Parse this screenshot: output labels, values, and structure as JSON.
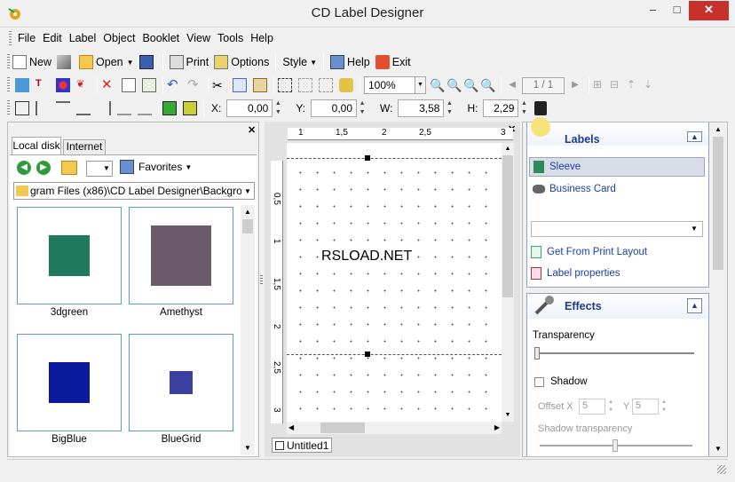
{
  "window": {
    "title": "CD Label Designer",
    "minimize": "–",
    "maximize": "□",
    "close": "✕"
  },
  "menu": [
    "File",
    "Edit",
    "Label",
    "Object",
    "Booklet",
    "View",
    "Tools",
    "Help"
  ],
  "toolbar1": {
    "new": "New",
    "open": "Open",
    "print": "Print",
    "options": "Options",
    "style": "Style",
    "help": "Help",
    "exit": "Exit"
  },
  "toolbar2": {
    "zoom": "100%",
    "page": "1 / 1"
  },
  "toolbar3": {
    "x_label": "X:",
    "x_value": "0,00",
    "y_label": "Y:",
    "y_value": "0,00",
    "w_label": "W:",
    "w_value": "3,58",
    "h_label": "H:",
    "h_value": "2,29"
  },
  "left_panel": {
    "tabs": [
      "Local disk",
      "Internet"
    ],
    "favorites": "Favorites",
    "path": "gram Files (x86)\\CD Label Designer\\Backgrounds",
    "thumbnails": [
      {
        "label": "3dgreen",
        "color": "#1e7a5c"
      },
      {
        "label": "Amethyst",
        "color": "#6b5a6a"
      },
      {
        "label": "BigBlue",
        "color": "#0a1a9a"
      },
      {
        "label": "BlueGrid",
        "color": "#3a3fa0"
      }
    ]
  },
  "canvas": {
    "ruler_top": [
      "1",
      "1,5",
      "2",
      "2,5",
      "3"
    ],
    "ruler_left": [
      "0,5",
      "1",
      "1,5",
      "2",
      "2,5",
      "3"
    ],
    "text": "RSLOAD.NET",
    "doc_tab": "Untitled1"
  },
  "right_panel": {
    "labels_header": "Labels",
    "label_items": [
      "Sleeve",
      "Business Card"
    ],
    "get_layout": "Get From Print Layout",
    "label_properties": "Label properties",
    "effects_header": "Effects",
    "transparency": "Transparency",
    "shadow": "Shadow",
    "offset_x_label": "Offset X",
    "offset_x": "5",
    "offset_y_label": "Y",
    "offset_y": "5",
    "shadow_transparency": "Shadow transparency"
  }
}
